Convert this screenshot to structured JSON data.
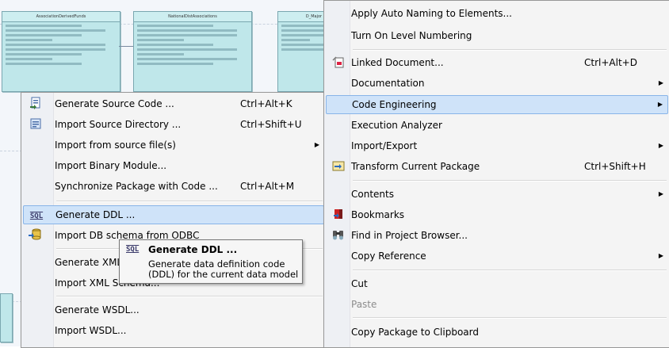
{
  "diagram": {
    "classes": [
      {
        "title": "AssociationDerivedFunds"
      },
      {
        "title": "NationalDistAssociations"
      },
      {
        "title": "D_Major"
      }
    ]
  },
  "left_menu": {
    "items": [
      {
        "label": "Generate Source Code ...",
        "shortcut": "Ctrl+Alt+K",
        "icon": "generate-code-icon"
      },
      {
        "label": "Import Source Directory ...",
        "shortcut": "Ctrl+Shift+U",
        "icon": "import-directory-icon"
      },
      {
        "label": "Import from source file(s)",
        "submenu": true
      },
      {
        "label": "Import Binary Module..."
      },
      {
        "label": "Synchronize Package with Code ...",
        "shortcut": "Ctrl+Alt+M"
      },
      {
        "label": "Generate DDL ...",
        "icon": "sql-icon",
        "highlighted": true
      },
      {
        "label": "Import DB schema from ODBC",
        "icon": "import-db-icon"
      },
      {
        "label": "Generate XML"
      },
      {
        "label": "Import XML Schema..."
      },
      {
        "label": "Generate WSDL..."
      },
      {
        "label": "Import WSDL..."
      }
    ]
  },
  "tooltip": {
    "icon_text": "SQL",
    "title": "Generate DDL ...",
    "description": "Generate data definition code (DDL) for the current data model"
  },
  "right_menu": {
    "items": [
      {
        "label": "Apply Auto Naming to Elements..."
      },
      {
        "label": "Turn On Level Numbering"
      },
      {
        "label": "Linked Document...",
        "shortcut": "Ctrl+Alt+D",
        "icon": "linked-document-icon"
      },
      {
        "label": "Documentation",
        "submenu": true
      },
      {
        "label": "Code Engineering",
        "submenu": true,
        "highlighted": true
      },
      {
        "label": "Execution Analyzer"
      },
      {
        "label": "Import/Export",
        "submenu": true
      },
      {
        "label": "Transform Current Package",
        "shortcut": "Ctrl+Shift+H",
        "icon": "transform-icon"
      },
      {
        "label": "Contents",
        "submenu": true
      },
      {
        "label": "Bookmarks",
        "icon": "bookmark-icon"
      },
      {
        "label": "Find in Project Browser...",
        "icon": "find-icon"
      },
      {
        "label": "Copy Reference",
        "submenu": true
      },
      {
        "label": "Cut"
      },
      {
        "label": "Paste",
        "disabled": true
      },
      {
        "label": "Copy Package to Clipboard"
      }
    ]
  },
  "colors": {
    "highlight_bg": "#cfe3f9",
    "highlight_border": "#88b4e8",
    "menu_bg": "#f4f4f4",
    "class_fill": "#bfe7ea"
  }
}
